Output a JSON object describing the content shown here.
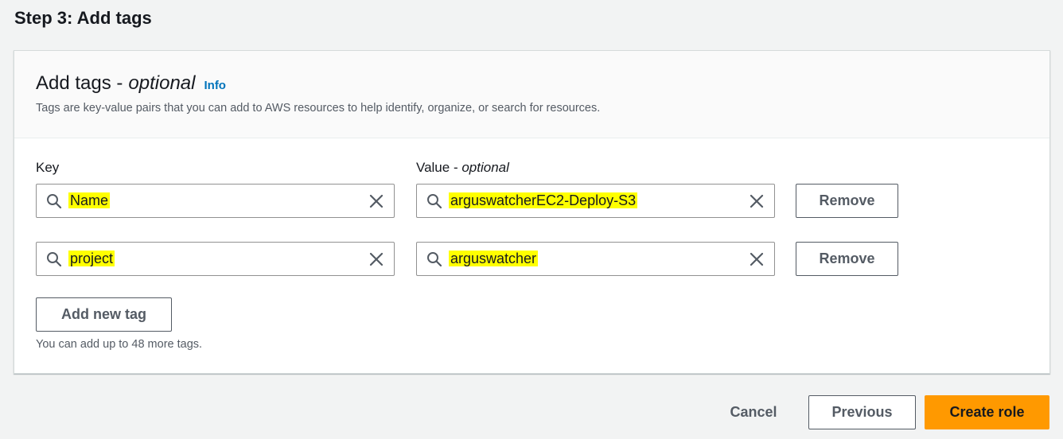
{
  "step_title": "Step 3: Add tags",
  "panel": {
    "title": "Add tags -",
    "title_optional": "optional",
    "info_link": "Info",
    "description": "Tags are key-value pairs that you can add to AWS resources to help identify, organize, or search for resources."
  },
  "columns": {
    "key_label": "Key",
    "value_label": "Value -",
    "value_optional": "optional"
  },
  "tags": [
    {
      "key": "Name",
      "value": "arguswatcherEC2-Deploy-S3",
      "remove_label": "Remove"
    },
    {
      "key": "project",
      "value": "arguswatcher",
      "remove_label": "Remove"
    }
  ],
  "add_new_tag_label": "Add new tag",
  "limit_hint": "You can add up to 48 more tags.",
  "footer": {
    "cancel_label": "Cancel",
    "previous_label": "Previous",
    "create_label": "Create role"
  },
  "colors": {
    "primary_button": "#ff9900",
    "link": "#0073bb",
    "highlight": "#ffff00"
  },
  "icons": {
    "search": "search-icon",
    "clear": "close-icon"
  }
}
